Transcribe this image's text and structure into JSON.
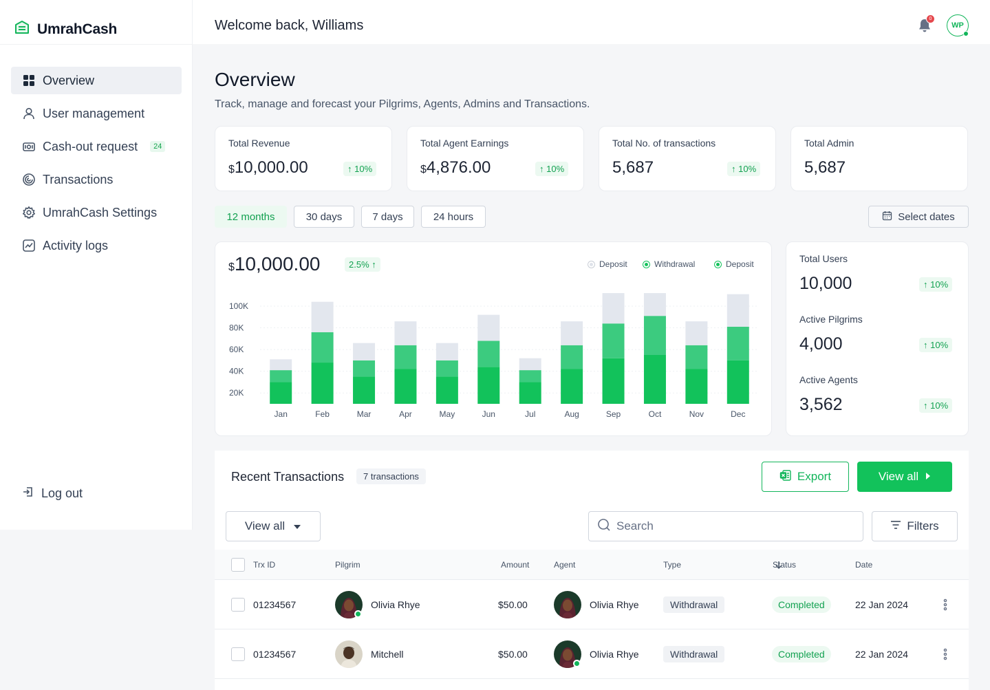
{
  "brand": {
    "name": "UmrahCash"
  },
  "header": {
    "welcome": "Welcome back, Williams",
    "notif_count": "0",
    "avatar_initials": "WP"
  },
  "sidebar": {
    "items": [
      {
        "label": "Overview",
        "icon": "grid-icon",
        "active": true
      },
      {
        "label": "User management",
        "icon": "user-icon"
      },
      {
        "label": "Cash-out request",
        "icon": "cash-icon",
        "badge": "24"
      },
      {
        "label": "Transactions",
        "icon": "spiral-icon"
      },
      {
        "label": "UmrahCash Settings",
        "icon": "gear-icon"
      },
      {
        "label": "Activity logs",
        "icon": "chart-line-icon"
      }
    ],
    "logout": "Log out"
  },
  "main": {
    "title": "Overview",
    "subtitle": "Track, manage and forecast your Pilgrims, Agents, Admins and Transactions.",
    "stats": [
      {
        "label": "Total Revenue",
        "currency": "$",
        "value": "10,000.00",
        "change": "10%"
      },
      {
        "label": "Total Agent Earnings",
        "currency": "$",
        "value": "4,876.00",
        "change": "10%"
      },
      {
        "label": "Total No. of transactions",
        "currency": "",
        "value": "5,687",
        "change": "10%"
      },
      {
        "label": "Total Admin",
        "currency": "",
        "value": "5,687",
        "change": ""
      }
    ],
    "ranges": [
      "12 months",
      "30 days",
      "7 days",
      "24 hours"
    ],
    "selected_range": "12 months",
    "select_dates": "Select dates"
  },
  "revenue_chart": {
    "currency": "$",
    "total": "10,000.00",
    "change": "2.5%",
    "legend": [
      "Deposit",
      "Withdrawal",
      "Deposit"
    ]
  },
  "chart_data": {
    "type": "bar",
    "stacked": true,
    "categories": [
      "Jan",
      "Feb",
      "Mar",
      "Apr",
      "May",
      "Jun",
      "Jul",
      "Aug",
      "Sep",
      "Oct",
      "Nov",
      "Dec"
    ],
    "y_ticks": [
      "100K",
      "80K",
      "60K",
      "40K",
      "20K"
    ],
    "ylim": [
      10000,
      100000
    ],
    "series": [
      {
        "name": "Deposit",
        "color": "#12c25b",
        "values": [
          20000,
          38000,
          25000,
          32000,
          25000,
          34000,
          20000,
          32000,
          42000,
          45000,
          32000,
          40000
        ]
      },
      {
        "name": "Withdrawal",
        "color": "#3ccb7f",
        "values": [
          11000,
          28000,
          15000,
          22000,
          15000,
          24000,
          11000,
          22000,
          32000,
          36000,
          22000,
          31000
        ]
      },
      {
        "name": "Deposit",
        "color": "#e3e7ee",
        "values": [
          10000,
          28000,
          16000,
          22000,
          16000,
          24000,
          11000,
          22000,
          28000,
          21000,
          22000,
          30000
        ]
      }
    ],
    "grid": true
  },
  "users": [
    {
      "label": "Total Users",
      "value": "10,000",
      "change": "10%"
    },
    {
      "label": "Active Pilgrims",
      "value": "4,000",
      "change": "10%"
    },
    {
      "label": "Active Agents",
      "value": "3,562",
      "change": "10%"
    }
  ],
  "transactions": {
    "title": "Recent Transactions",
    "count": "7 transactions",
    "export": "Export",
    "view_all": "View all",
    "filter_select": "View all",
    "search_placeholder": "Search",
    "filters": "Filters",
    "columns": [
      "Trx ID",
      "Pilgrim",
      "Amount",
      "Agent",
      "Type",
      "Status",
      "Date"
    ],
    "rows": [
      {
        "id": "01234567",
        "pilgrim": "Olivia Rhye",
        "amount": "$50.00",
        "agent": "Olivia Rhye",
        "type": "Withdrawal",
        "status": "Completed",
        "date": "22 Jan 2024"
      },
      {
        "id": "01234567",
        "pilgrim": "Mitchell",
        "amount": "$50.00",
        "agent": "Olivia Rhye",
        "type": "Withdrawal",
        "status": "Completed",
        "date": "22 Jan 2024"
      }
    ]
  },
  "colors": {
    "brand": "#12c25b",
    "brand_dark": "#12a150",
    "danger": "#e5484d"
  }
}
